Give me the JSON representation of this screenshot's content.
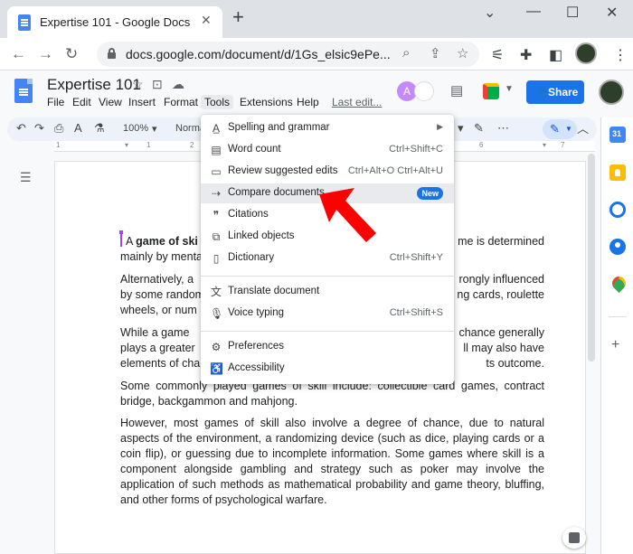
{
  "browser": {
    "tab_title": "Expertise 101 - Google Docs",
    "tab_close": "✕",
    "new_tab": "+",
    "url": "docs.google.com/document/d/1Gs_elsic9ePe...",
    "window_controls": {
      "minimize": "⌄",
      "restore": "—",
      "maximize": "☐",
      "close": "✕"
    }
  },
  "docs": {
    "title": "Expertise 101",
    "menus": [
      "File",
      "Edit",
      "View",
      "Insert",
      "Format",
      "Tools",
      "Extensions",
      "Help"
    ],
    "last_edit": "Last edit...",
    "avatar_letter": "A",
    "share_label": "Share"
  },
  "toolbar": {
    "zoom": "100%",
    "style": "Norma"
  },
  "ruler": {
    "marks": [
      "1",
      "1",
      "2",
      "6",
      "7"
    ]
  },
  "tools_menu": {
    "items": [
      {
        "label": "Spelling and grammar",
        "icon": "spellcheck-icon",
        "glyph": "A̲",
        "shortcut": "",
        "submenu": true
      },
      {
        "label": "Word count",
        "icon": "word-count-icon",
        "glyph": "▤",
        "shortcut": "Ctrl+Shift+C"
      },
      {
        "label": "Review suggested edits",
        "icon": "review-edits-icon",
        "glyph": "▭",
        "shortcut": "Ctrl+Alt+O Ctrl+Alt+U"
      },
      {
        "label": "Compare documents",
        "icon": "compare-icon",
        "glyph": "⇢",
        "shortcut": "",
        "badge": "New",
        "highlighted": true
      },
      {
        "label": "Citations",
        "icon": "citations-icon",
        "glyph": "❞",
        "shortcut": ""
      },
      {
        "label": "Linked objects",
        "icon": "linked-objects-icon",
        "glyph": "⧉",
        "shortcut": ""
      },
      {
        "label": "Dictionary",
        "icon": "dictionary-icon",
        "glyph": "▯",
        "shortcut": "Ctrl+Shift+Y"
      },
      {
        "label": "Translate document",
        "icon": "translate-icon",
        "glyph": "文",
        "shortcut": ""
      },
      {
        "label": "Voice typing",
        "icon": "microphone-icon",
        "glyph": "🎙",
        "shortcut": "Ctrl+Shift+S"
      },
      {
        "label": "Preferences",
        "icon": "preferences-icon",
        "glyph": "⚙",
        "shortcut": ""
      },
      {
        "label": "Accessibility",
        "icon": "accessibility-icon",
        "glyph": "♿",
        "shortcut": ""
      }
    ]
  },
  "document": {
    "paragraphs": [
      {
        "left": "A ",
        "bold": "game of ski",
        "right": "me is determined",
        "line2": "mainly by menta"
      },
      {
        "left": "Alternatively, a",
        "right": "rongly influenced",
        "line2l": "by some random",
        "line2r": "ng cards, roulette",
        "line3": "wheels, or num"
      },
      {
        "left": "While a game",
        "right": "chance generally",
        "line2l": "plays a greater",
        "line2r": "ll may also have",
        "line3l": "elements of cha",
        "line3r": "ts outcome."
      },
      {
        "text": "Some commonly played games of skill include: collectible card games, contract bridge, backgammon and mahjong."
      },
      {
        "text": "However, most games of skill also involve a degree of chance, due to natural aspects of the environment, a randomizing device (such as dice, playing cards or a coin flip), or guessing due to incomplete information. Some games where skill is a component alongside gambling and strategy such as poker may involve the application of such methods as mathematical probability and game theory, bluffing, and other forms of psychological warfare."
      }
    ]
  },
  "colors": {
    "accent": "#1a73e8",
    "arrow": "#ff0000",
    "tab_bar": "#dee1e6"
  }
}
